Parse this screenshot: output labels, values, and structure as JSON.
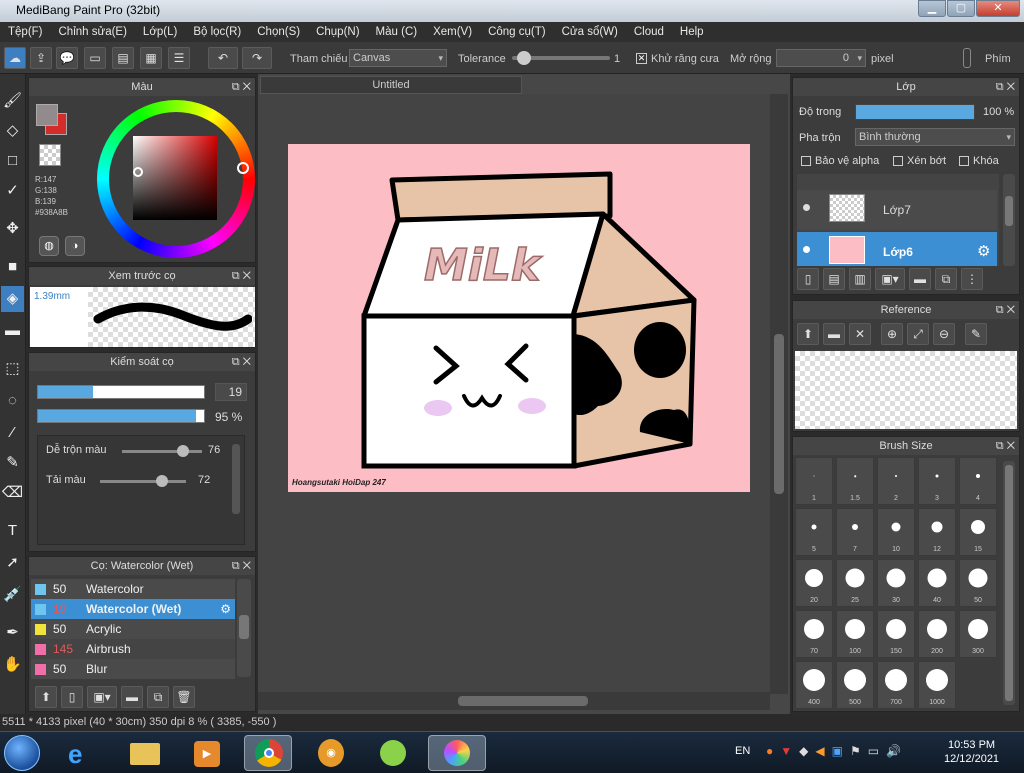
{
  "window": {
    "title": "MediBang Paint Pro (32bit)",
    "controls": [
      "▁",
      "▢",
      "✕"
    ]
  },
  "menu": [
    "Tệp(F)",
    "Chỉnh sửa(E)",
    "Lớp(L)",
    "Bộ lọc(R)",
    "Chọn(S)",
    "Chụp(N)",
    "Màu (C)",
    "Xem(V)",
    "Công cụ(T)",
    "Cửa sổ(W)",
    "Cloud",
    "Help"
  ],
  "toolbar": {
    "reference_label": "Tham chiếu",
    "reference_value": "Canvas",
    "tolerance_label": "Tolerance",
    "tolerance_value": "1",
    "tolerance_level": 0.05,
    "antialias_label": "Khử răng cưa",
    "expand_label": "Mở rộng",
    "expand_value": "0",
    "expand_unit": "pixel",
    "keys_label": "Phím"
  },
  "color_panel": {
    "title": "Màu",
    "r": "R:147",
    "g": "G:138",
    "b": "B:139",
    "hex": "#938A8B",
    "main_color": "#d42b2b"
  },
  "brush_preview": {
    "title": "Xem trước cọ",
    "size": "1.39mm"
  },
  "brush_control": {
    "title": "Kiểm soát cọ",
    "size": "19",
    "size_level": 0.33,
    "opacity": "95 %",
    "opacity_level": 0.95,
    "mix_label": "Dễ trộn màu",
    "mix_value": "76",
    "mix_level": 0.76,
    "amount_label": "Tải màu",
    "amount_value": "72",
    "amount_level": 0.72
  },
  "brush_list": {
    "title": "Cọ: Watercolor (Wet)",
    "items": [
      {
        "num": "50",
        "name": "Watercolor",
        "color": "#6ec6ef",
        "selected": false
      },
      {
        "num": "19",
        "name": "Watercolor (Wet)",
        "color": "#6ec6ef",
        "selected": true
      },
      {
        "num": "50",
        "name": "Acrylic",
        "color": "#f2e33a",
        "selected": false
      },
      {
        "num": "145",
        "name": "Airbrush",
        "color": "#f06fa8",
        "selected": false
      },
      {
        "num": "50",
        "name": "Blur",
        "color": "#f06fa8",
        "selected": false
      }
    ]
  },
  "canvas": {
    "tab": "Untitled",
    "word": "MiLk",
    "signature": "Hoangsutaki HoiDap 247"
  },
  "layer_panel": {
    "title": "Lớp",
    "opacity_label": "Độ trong",
    "opacity_value": "100 %",
    "opacity_level": 1.0,
    "blend_label": "Pha trộn",
    "blend_value": "Bình thường",
    "protect_alpha": "Bảo vệ alpha",
    "clipping": "Xén bớt",
    "lock": "Khóa",
    "layers": [
      {
        "name": "Lớp7",
        "selected": false
      },
      {
        "name": "Lớp6",
        "selected": true
      }
    ]
  },
  "reference_panel": {
    "title": "Reference"
  },
  "brush_size_panel": {
    "title": "Brush Size",
    "sizes": [
      "1",
      "1.5",
      "2",
      "3",
      "4",
      "5",
      "7",
      "10",
      "12",
      "15",
      "20",
      "25",
      "30",
      "40",
      "50",
      "70",
      "100",
      "150",
      "200",
      "300",
      "400",
      "500",
      "700",
      "1000"
    ]
  },
  "status_bar": {
    "text": "5511 * 4133 pixel  (40 * 30cm)  350 dpi  8 %  ( 3385, -550 )"
  },
  "taskbar": {
    "lang": "EN",
    "time": "10:53 PM",
    "date": "12/12/2021"
  }
}
